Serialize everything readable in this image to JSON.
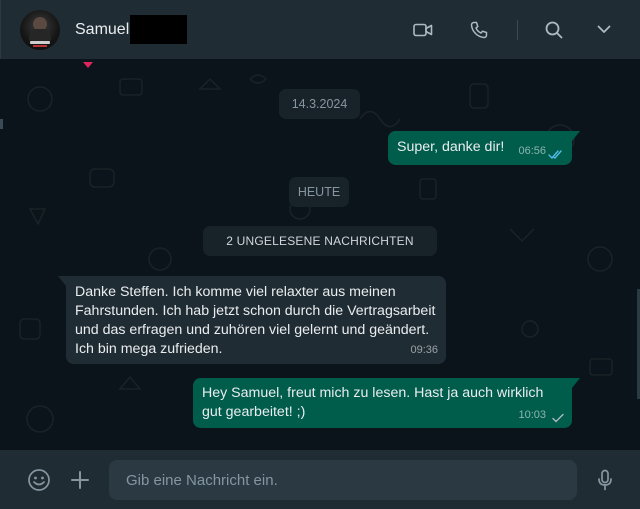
{
  "header": {
    "contact_name": "Samuel",
    "icons": [
      "video-call-icon",
      "voice-call-icon",
      "search-icon",
      "chevron-down-icon"
    ]
  },
  "chat": {
    "date_pill": "14.3.2024",
    "today_pill": "HEUTE",
    "unread_pill": "2 UNGELESENE NACHRICHTEN",
    "messages": [
      {
        "direction": "outgoing",
        "text": "Super, danke dir!",
        "time": "06:56",
        "status": "read"
      },
      {
        "direction": "incoming",
        "text": "Danke Steffen. Ich komme viel relaxter aus meinen Fahrstunden. Ich hab jetzt schon durch die Vertragsarbeit und das erfragen und zuhören viel gelernt und geändert. Ich bin mega zufrieden.",
        "time": "09:36"
      },
      {
        "direction": "outgoing",
        "text": "Hey Samuel, freut mich zu lesen. Hast ja auch wirklich gut gearbeitet! ;)",
        "time": "10:03",
        "status": "delivered"
      }
    ]
  },
  "footer": {
    "input_placeholder": "Gib eine Nachricht ein.",
    "icons": [
      "emoji-icon",
      "attach-plus-icon",
      "microphone-icon"
    ]
  },
  "colors": {
    "header_bg": "#202c33",
    "chat_bg": "#0b141a",
    "outgoing_bubble": "#005c4b",
    "incoming_bubble": "#202c33",
    "read_ticks": "#53bdeb"
  }
}
